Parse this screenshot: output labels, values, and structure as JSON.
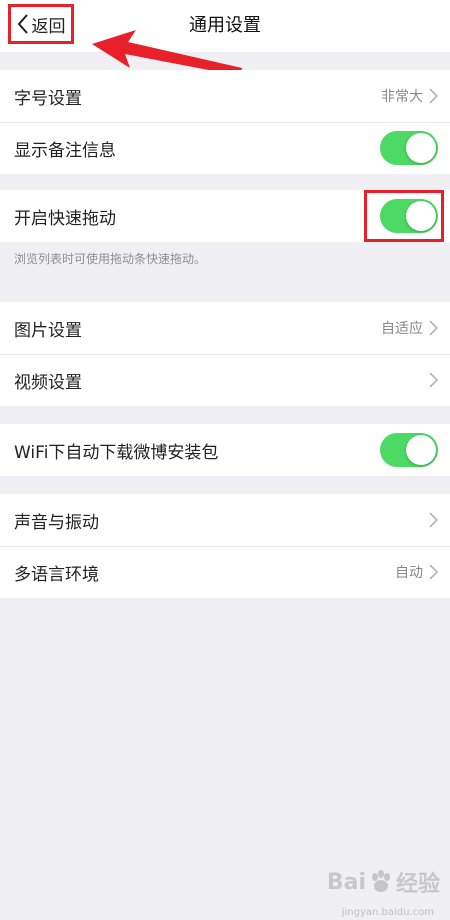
{
  "header": {
    "back_label": "返回",
    "title": "通用设置"
  },
  "groups": [
    {
      "rows": [
        {
          "label": "字号设置",
          "value": "非常大",
          "type": "link"
        },
        {
          "label": "显示备注信息",
          "type": "toggle",
          "on": true
        }
      ]
    },
    {
      "rows": [
        {
          "label": "开启快速拖动",
          "type": "toggle",
          "on": true
        }
      ],
      "note": "浏览列表时可使用拖动条快速拖动。"
    },
    {
      "rows": [
        {
          "label": "图片设置",
          "value": "自适应",
          "type": "link"
        },
        {
          "label": "视频设置",
          "type": "link"
        }
      ]
    },
    {
      "rows": [
        {
          "label": "WiFi下自动下载微博安装包",
          "type": "toggle",
          "on": true
        }
      ]
    },
    {
      "rows": [
        {
          "label": "声音与振动",
          "type": "link"
        },
        {
          "label": "多语言环境",
          "value": "自动",
          "type": "link"
        }
      ]
    }
  ],
  "colors": {
    "toggle_on": "#4cd964",
    "highlight": "#e8202a",
    "background": "#efeff4"
  },
  "watermark": {
    "brand": "Bai",
    "suffix": "经验",
    "sub": "jingyan.baidu.com"
  }
}
